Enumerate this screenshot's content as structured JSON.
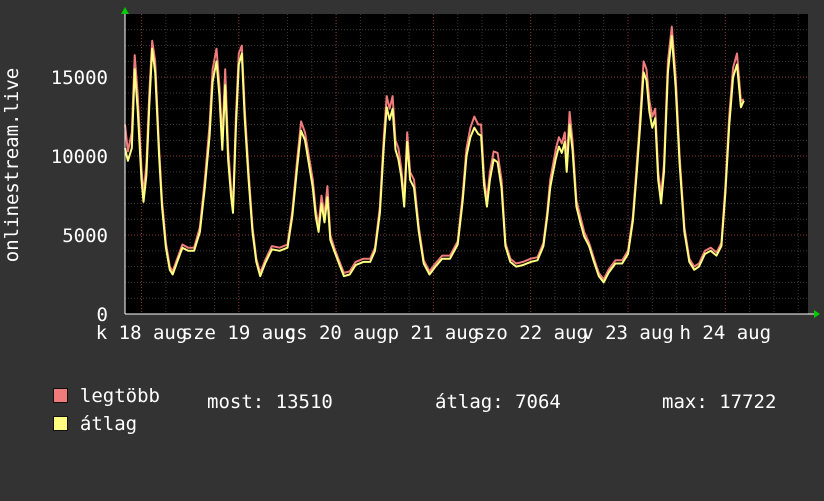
{
  "chart_data": {
    "type": "line",
    "ylabel": "onlinestream.live",
    "ylim": [
      0,
      19000
    ],
    "yticks": [
      0,
      5000,
      10000,
      15000
    ],
    "grid": true,
    "xlim_days": [
      17.83,
      24.85
    ],
    "xticks": [
      {
        "label": "k 18 aug",
        "day": 18.0
      },
      {
        "label": "sze 19 aug",
        "day": 19.0
      },
      {
        "label": "cs 20 aug",
        "day": 20.0
      },
      {
        "label": "p 21 aug",
        "day": 21.0
      },
      {
        "label": "szo 22 aug",
        "day": 22.0
      },
      {
        "label": "v 23 aug",
        "day": 23.0
      },
      {
        "label": "h 24 aug",
        "day": 24.0
      }
    ],
    "series": [
      {
        "name": "legtöbb",
        "color": "#f07b7b",
        "points": [
          [
            17.83,
            12000
          ],
          [
            17.86,
            10300
          ],
          [
            17.9,
            11500
          ],
          [
            17.93,
            16400
          ],
          [
            17.96,
            14000
          ],
          [
            18.0,
            9200
          ],
          [
            18.02,
            7600
          ],
          [
            18.05,
            9500
          ],
          [
            18.08,
            14000
          ],
          [
            18.11,
            17300
          ],
          [
            18.14,
            16000
          ],
          [
            18.18,
            10500
          ],
          [
            18.21,
            7200
          ],
          [
            18.25,
            4500
          ],
          [
            18.29,
            3000
          ],
          [
            18.32,
            2700
          ],
          [
            18.36,
            3400
          ],
          [
            18.42,
            4400
          ],
          [
            18.48,
            4200
          ],
          [
            18.54,
            4200
          ],
          [
            18.6,
            5500
          ],
          [
            18.65,
            8500
          ],
          [
            18.7,
            12000
          ],
          [
            18.73,
            15500
          ],
          [
            18.77,
            16800
          ],
          [
            18.8,
            14500
          ],
          [
            18.83,
            11000
          ],
          [
            18.86,
            15500
          ],
          [
            18.89,
            10500
          ],
          [
            18.92,
            8000
          ],
          [
            18.94,
            6800
          ],
          [
            18.97,
            12500
          ],
          [
            19.0,
            16500
          ],
          [
            19.03,
            17000
          ],
          [
            19.06,
            13000
          ],
          [
            19.1,
            9000
          ],
          [
            19.14,
            5500
          ],
          [
            19.18,
            3500
          ],
          [
            19.22,
            2600
          ],
          [
            19.27,
            3400
          ],
          [
            19.34,
            4300
          ],
          [
            19.42,
            4200
          ],
          [
            19.5,
            4400
          ],
          [
            19.55,
            6500
          ],
          [
            19.6,
            9800
          ],
          [
            19.64,
            12200
          ],
          [
            19.68,
            11500
          ],
          [
            19.72,
            10000
          ],
          [
            19.76,
            8500
          ],
          [
            19.79,
            6600
          ],
          [
            19.82,
            5600
          ],
          [
            19.85,
            7500
          ],
          [
            19.88,
            6200
          ],
          [
            19.91,
            8100
          ],
          [
            19.94,
            5000
          ],
          [
            19.98,
            4200
          ],
          [
            20.03,
            3400
          ],
          [
            20.08,
            2600
          ],
          [
            20.14,
            2700
          ],
          [
            20.2,
            3300
          ],
          [
            20.28,
            3500
          ],
          [
            20.35,
            3500
          ],
          [
            20.4,
            4200
          ],
          [
            20.45,
            6800
          ],
          [
            20.49,
            11200
          ],
          [
            20.52,
            13800
          ],
          [
            20.55,
            13000
          ],
          [
            20.58,
            13800
          ],
          [
            20.61,
            11000
          ],
          [
            20.64,
            10500
          ],
          [
            20.67,
            9200
          ],
          [
            20.7,
            7200
          ],
          [
            20.73,
            11500
          ],
          [
            20.76,
            9000
          ],
          [
            20.8,
            8500
          ],
          [
            20.85,
            5500
          ],
          [
            20.9,
            3400
          ],
          [
            20.96,
            2700
          ],
          [
            21.02,
            3200
          ],
          [
            21.09,
            3700
          ],
          [
            21.17,
            3700
          ],
          [
            21.25,
            4600
          ],
          [
            21.3,
            7500
          ],
          [
            21.34,
            10500
          ],
          [
            21.38,
            11800
          ],
          [
            21.42,
            12500
          ],
          [
            21.46,
            12000
          ],
          [
            21.49,
            12000
          ],
          [
            21.52,
            8700
          ],
          [
            21.55,
            7200
          ],
          [
            21.58,
            9000
          ],
          [
            21.62,
            10300
          ],
          [
            21.66,
            10200
          ],
          [
            21.7,
            8500
          ],
          [
            21.74,
            4500
          ],
          [
            21.79,
            3500
          ],
          [
            21.85,
            3200
          ],
          [
            21.92,
            3300
          ],
          [
            22.0,
            3500
          ],
          [
            22.07,
            3600
          ],
          [
            22.13,
            4500
          ],
          [
            22.17,
            6500
          ],
          [
            22.2,
            8500
          ],
          [
            22.23,
            9500
          ],
          [
            22.26,
            10500
          ],
          [
            22.29,
            11200
          ],
          [
            22.32,
            10800
          ],
          [
            22.35,
            11500
          ],
          [
            22.37,
            9500
          ],
          [
            22.4,
            12800
          ],
          [
            22.43,
            11000
          ],
          [
            22.47,
            7200
          ],
          [
            22.51,
            6200
          ],
          [
            22.55,
            5200
          ],
          [
            22.6,
            4500
          ],
          [
            22.65,
            3500
          ],
          [
            22.7,
            2600
          ],
          [
            22.75,
            2200
          ],
          [
            22.8,
            2800
          ],
          [
            22.87,
            3400
          ],
          [
            22.94,
            3400
          ],
          [
            23.0,
            4000
          ],
          [
            23.05,
            6200
          ],
          [
            23.09,
            9500
          ],
          [
            23.13,
            13000
          ],
          [
            23.16,
            16000
          ],
          [
            23.19,
            15500
          ],
          [
            23.22,
            13500
          ],
          [
            23.25,
            12500
          ],
          [
            23.28,
            13000
          ],
          [
            23.31,
            9000
          ],
          [
            23.34,
            7500
          ],
          [
            23.37,
            9500
          ],
          [
            23.41,
            16000
          ],
          [
            23.45,
            18200
          ],
          [
            23.49,
            15000
          ],
          [
            23.53,
            10000
          ],
          [
            23.58,
            5500
          ],
          [
            23.63,
            3500
          ],
          [
            23.68,
            3000
          ],
          [
            23.73,
            3200
          ],
          [
            23.79,
            4000
          ],
          [
            23.85,
            4200
          ],
          [
            23.91,
            3900
          ],
          [
            23.96,
            4500
          ],
          [
            24.0,
            8000
          ],
          [
            24.04,
            12500
          ],
          [
            24.08,
            15600
          ],
          [
            24.12,
            16500
          ],
          [
            24.16,
            13500
          ],
          [
            24.19,
            13600
          ]
        ]
      },
      {
        "name": "átlag",
        "color": "#ffff80",
        "points": [
          [
            17.83,
            10500
          ],
          [
            17.86,
            9700
          ],
          [
            17.9,
            10500
          ],
          [
            17.93,
            15500
          ],
          [
            17.96,
            13000
          ],
          [
            18.0,
            8500
          ],
          [
            18.02,
            7100
          ],
          [
            18.05,
            8800
          ],
          [
            18.08,
            13200
          ],
          [
            18.11,
            16800
          ],
          [
            18.14,
            15300
          ],
          [
            18.18,
            10000
          ],
          [
            18.21,
            6800
          ],
          [
            18.25,
            4200
          ],
          [
            18.29,
            2800
          ],
          [
            18.32,
            2500
          ],
          [
            18.36,
            3200
          ],
          [
            18.42,
            4200
          ],
          [
            18.48,
            4000
          ],
          [
            18.54,
            4000
          ],
          [
            18.6,
            5200
          ],
          [
            18.65,
            8000
          ],
          [
            18.7,
            11300
          ],
          [
            18.73,
            14700
          ],
          [
            18.77,
            16000
          ],
          [
            18.8,
            13800
          ],
          [
            18.83,
            10400
          ],
          [
            18.86,
            14500
          ],
          [
            18.89,
            9800
          ],
          [
            18.92,
            7500
          ],
          [
            18.94,
            6400
          ],
          [
            18.97,
            11800
          ],
          [
            19.0,
            15800
          ],
          [
            19.03,
            16500
          ],
          [
            19.06,
            12400
          ],
          [
            19.1,
            8500
          ],
          [
            19.14,
            5200
          ],
          [
            19.18,
            3300
          ],
          [
            19.22,
            2400
          ],
          [
            19.27,
            3200
          ],
          [
            19.34,
            4100
          ],
          [
            19.42,
            4000
          ],
          [
            19.5,
            4200
          ],
          [
            19.55,
            6200
          ],
          [
            19.6,
            9300
          ],
          [
            19.64,
            11600
          ],
          [
            19.68,
            11000
          ],
          [
            19.72,
            9500
          ],
          [
            19.76,
            8000
          ],
          [
            19.79,
            6200
          ],
          [
            19.82,
            5200
          ],
          [
            19.85,
            7000
          ],
          [
            19.88,
            5800
          ],
          [
            19.91,
            7400
          ],
          [
            19.94,
            4700
          ],
          [
            19.98,
            4000
          ],
          [
            20.03,
            3200
          ],
          [
            20.08,
            2400
          ],
          [
            20.14,
            2500
          ],
          [
            20.2,
            3100
          ],
          [
            20.28,
            3300
          ],
          [
            20.35,
            3300
          ],
          [
            20.4,
            4000
          ],
          [
            20.45,
            6400
          ],
          [
            20.49,
            10600
          ],
          [
            20.52,
            13100
          ],
          [
            20.55,
            12300
          ],
          [
            20.58,
            13000
          ],
          [
            20.61,
            10400
          ],
          [
            20.64,
            9800
          ],
          [
            20.67,
            8700
          ],
          [
            20.7,
            6800
          ],
          [
            20.73,
            10900
          ],
          [
            20.76,
            8500
          ],
          [
            20.8,
            8000
          ],
          [
            20.85,
            5200
          ],
          [
            20.9,
            3200
          ],
          [
            20.96,
            2500
          ],
          [
            21.02,
            3000
          ],
          [
            21.09,
            3500
          ],
          [
            21.17,
            3500
          ],
          [
            21.25,
            4400
          ],
          [
            21.3,
            7100
          ],
          [
            21.34,
            10000
          ],
          [
            21.38,
            11200
          ],
          [
            21.42,
            11800
          ],
          [
            21.46,
            11400
          ],
          [
            21.49,
            11300
          ],
          [
            21.52,
            8200
          ],
          [
            21.55,
            6800
          ],
          [
            21.58,
            8500
          ],
          [
            21.62,
            9800
          ],
          [
            21.66,
            9600
          ],
          [
            21.7,
            8000
          ],
          [
            21.74,
            4300
          ],
          [
            21.79,
            3300
          ],
          [
            21.85,
            3000
          ],
          [
            21.92,
            3100
          ],
          [
            22.0,
            3300
          ],
          [
            22.07,
            3400
          ],
          [
            22.13,
            4300
          ],
          [
            22.17,
            6200
          ],
          [
            22.2,
            8000
          ],
          [
            22.23,
            9000
          ],
          [
            22.26,
            9900
          ],
          [
            22.29,
            10600
          ],
          [
            22.32,
            10200
          ],
          [
            22.35,
            10900
          ],
          [
            22.37,
            9000
          ],
          [
            22.4,
            12000
          ],
          [
            22.43,
            10400
          ],
          [
            22.47,
            6800
          ],
          [
            22.51,
            5800
          ],
          [
            22.55,
            4900
          ],
          [
            22.6,
            4300
          ],
          [
            22.65,
            3300
          ],
          [
            22.7,
            2400
          ],
          [
            22.75,
            2000
          ],
          [
            22.8,
            2600
          ],
          [
            22.87,
            3200
          ],
          [
            22.94,
            3200
          ],
          [
            23.0,
            3800
          ],
          [
            23.05,
            5900
          ],
          [
            23.09,
            9000
          ],
          [
            23.13,
            12400
          ],
          [
            23.16,
            15300
          ],
          [
            23.19,
            14800
          ],
          [
            23.22,
            12800
          ],
          [
            23.25,
            11800
          ],
          [
            23.28,
            12400
          ],
          [
            23.31,
            8500
          ],
          [
            23.34,
            7000
          ],
          [
            23.37,
            9000
          ],
          [
            23.41,
            15300
          ],
          [
            23.45,
            17600
          ],
          [
            23.49,
            14300
          ],
          [
            23.53,
            9500
          ],
          [
            23.58,
            5200
          ],
          [
            23.63,
            3300
          ],
          [
            23.68,
            2800
          ],
          [
            23.73,
            3000
          ],
          [
            23.79,
            3800
          ],
          [
            23.85,
            4000
          ],
          [
            23.91,
            3700
          ],
          [
            23.96,
            4300
          ],
          [
            24.0,
            7600
          ],
          [
            24.04,
            11900
          ],
          [
            24.08,
            15000
          ],
          [
            24.12,
            15800
          ],
          [
            24.16,
            13100
          ],
          [
            24.19,
            13510
          ]
        ]
      }
    ]
  },
  "legend": {
    "items": [
      {
        "label": "legtöbb",
        "color": "#f07b7b"
      },
      {
        "label": "átlag",
        "color": "#ffff80"
      }
    ],
    "stats": {
      "now": "most: 13510",
      "avg": "átlag: 7064",
      "max": "max: 17722"
    }
  },
  "colors": {
    "background": "#333333",
    "plot_background": "#000000",
    "grid_major": "#8a3a3a",
    "grid_minor": "#3a3a3a",
    "axis_arrow": "#00cc00"
  }
}
